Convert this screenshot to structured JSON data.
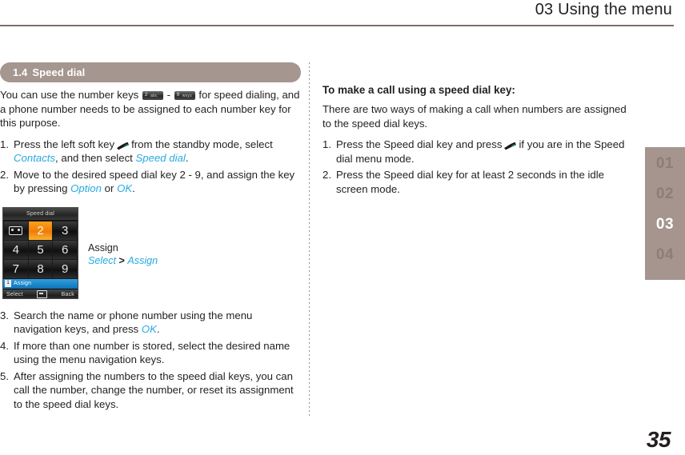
{
  "header": {
    "title": "03 Using the menu"
  },
  "chapter_tab": {
    "items": [
      {
        "label": "01",
        "active": false
      },
      {
        "label": "02",
        "active": false
      },
      {
        "label": "03",
        "active": true
      },
      {
        "label": "04",
        "active": false
      }
    ],
    "background_color": "#a5958e",
    "active_color": "#ffffff",
    "inactive_color": "#8d7d76"
  },
  "section": {
    "number": "1.4",
    "title": "Speed dial",
    "bar_color": "#a5968f"
  },
  "left_column": {
    "intro_pre": "You can use the number keys",
    "intro_between": "-",
    "intro_post": "for speed dialing, and a phone number needs to be assigned to each number key for this purpose.",
    "key_from": {
      "digit": "2",
      "letters": "abc"
    },
    "key_to": {
      "digit": "9",
      "letters": "wxyz"
    },
    "steps": [
      {
        "marker": "1.",
        "pre": "Press the left soft key",
        "icon": "send-key-icon",
        "mid": "from the standby mode, select",
        "ui1": "Contacts",
        "mid2": ", and then select",
        "ui2": "Speed dial",
        "post": "."
      },
      {
        "marker": "2.",
        "pre": "Move to the desired speed dial key 2 - 9, and assign the key by pressing",
        "ui1": "Option",
        "mid2": "or",
        "ui2": "OK",
        "post": "."
      }
    ],
    "steps_cont": [
      {
        "marker": "3.",
        "pre": "Search the name or phone number using the menu navigation keys, and press",
        "ui1": "OK",
        "post": "."
      },
      {
        "marker": "4.",
        "pre": "If more than one number is stored, select the desired name using the menu navigation keys.",
        "ui1": "",
        "post": ""
      },
      {
        "marker": "5.",
        "pre": "After assigning the numbers to the speed dial keys, you can call the number, change the number, or reset its assignment to the speed dial keys.",
        "ui1": "",
        "post": ""
      }
    ]
  },
  "figure": {
    "phone": {
      "screen_title": "Speed dial",
      "keys": [
        {
          "label": "voicemail-icon",
          "type": "icon",
          "selected": false
        },
        {
          "label": "2",
          "type": "digit",
          "selected": true
        },
        {
          "label": "3",
          "type": "digit",
          "selected": false
        },
        {
          "label": "4",
          "type": "digit",
          "selected": false
        },
        {
          "label": "5",
          "type": "digit",
          "selected": false
        },
        {
          "label": "6",
          "type": "digit",
          "selected": false
        },
        {
          "label": "7",
          "type": "digit",
          "selected": false
        },
        {
          "label": "8",
          "type": "digit",
          "selected": false
        },
        {
          "label": "9",
          "type": "digit",
          "selected": false
        }
      ],
      "highlight_index": "1",
      "highlight_label": "Assign",
      "softkey_left": "Select",
      "softkey_center": "center-key-icon",
      "softkey_right": "Back",
      "highlight_color": "#2f9ede",
      "selected_key_color": "#f07c0a"
    },
    "caption_title": "Assign",
    "caption_path_1": "Select",
    "caption_path_sep": ">",
    "caption_path_2": "Assign"
  },
  "right_column": {
    "heading": "To make a call using a speed dial key:",
    "lead": "There are two ways of making a call when numbers are assigned to the speed dial keys.",
    "steps": [
      {
        "marker": "1.",
        "pre": "Press the Speed dial key and press",
        "icon": "send-key-icon",
        "post": "if you are in the Speed dial menu mode."
      },
      {
        "marker": "2.",
        "pre": "Press the Speed dial key for at least 2 seconds in the idle screen mode.",
        "icon": "",
        "post": ""
      }
    ]
  },
  "page_number": "35",
  "colors": {
    "ui_reference": "#27aae1",
    "rule": "#7d6f6b",
    "text": "#231f20"
  }
}
